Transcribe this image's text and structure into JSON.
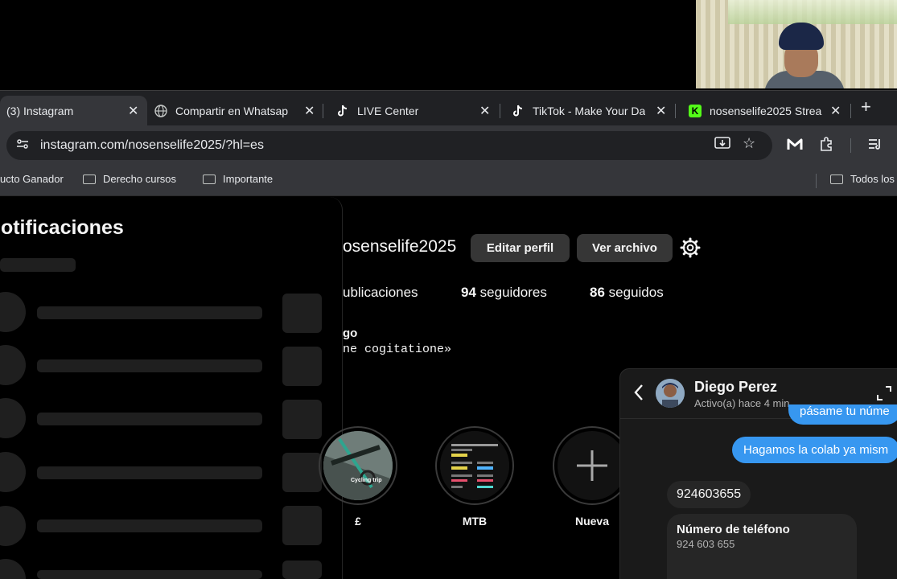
{
  "tabs": [
    {
      "title": "(3) Instagram",
      "icon": "instagram",
      "active": true
    },
    {
      "title": "Compartir en Whatsap",
      "icon": "globe"
    },
    {
      "title": "LIVE Center",
      "icon": "tiktok"
    },
    {
      "title": "TikTok - Make Your Da",
      "icon": "tiktok"
    },
    {
      "title": "nosenselife2025 Strea",
      "icon": "kick",
      "icon_color": "#53fc18"
    }
  ],
  "address": {
    "url": "instagram.com/nosenselife2025/?hl=es"
  },
  "bookmarks": [
    "ucto Ganador",
    "Derecho cursos",
    "Importante",
    "Todos los"
  ],
  "notifications": {
    "title": "lotificaciones"
  },
  "profile": {
    "username": "osenselife2025",
    "edit_label": "Editar perfil",
    "archive_label": "Ver archivo",
    "posts_label": "ublicaciones",
    "followers_count": "94",
    "followers_label": "seguidores",
    "following_count": "86",
    "following_label": "seguidos",
    "bio_name": "go",
    "bio_quote": "ne cogitatione»"
  },
  "highlights": [
    {
      "label": "£",
      "type": "cycling",
      "thumb_text": "Cycling trip"
    },
    {
      "label": "MTB",
      "type": "workout"
    },
    {
      "label": "Nueva",
      "type": "new"
    }
  ],
  "chat": {
    "name": "Diego Perez",
    "status": "Activo(a) hace 4 min",
    "messages_out": [
      "pásame tu núme",
      "Hagamos la colab ya mism"
    ],
    "message_in": "924603655",
    "contact_title": "Número de teléfono",
    "contact_number": "924 603 655"
  },
  "colors": {
    "accent": "#3797f0",
    "chrome_bg": "#202124",
    "toolbar_bg": "#35363a"
  }
}
